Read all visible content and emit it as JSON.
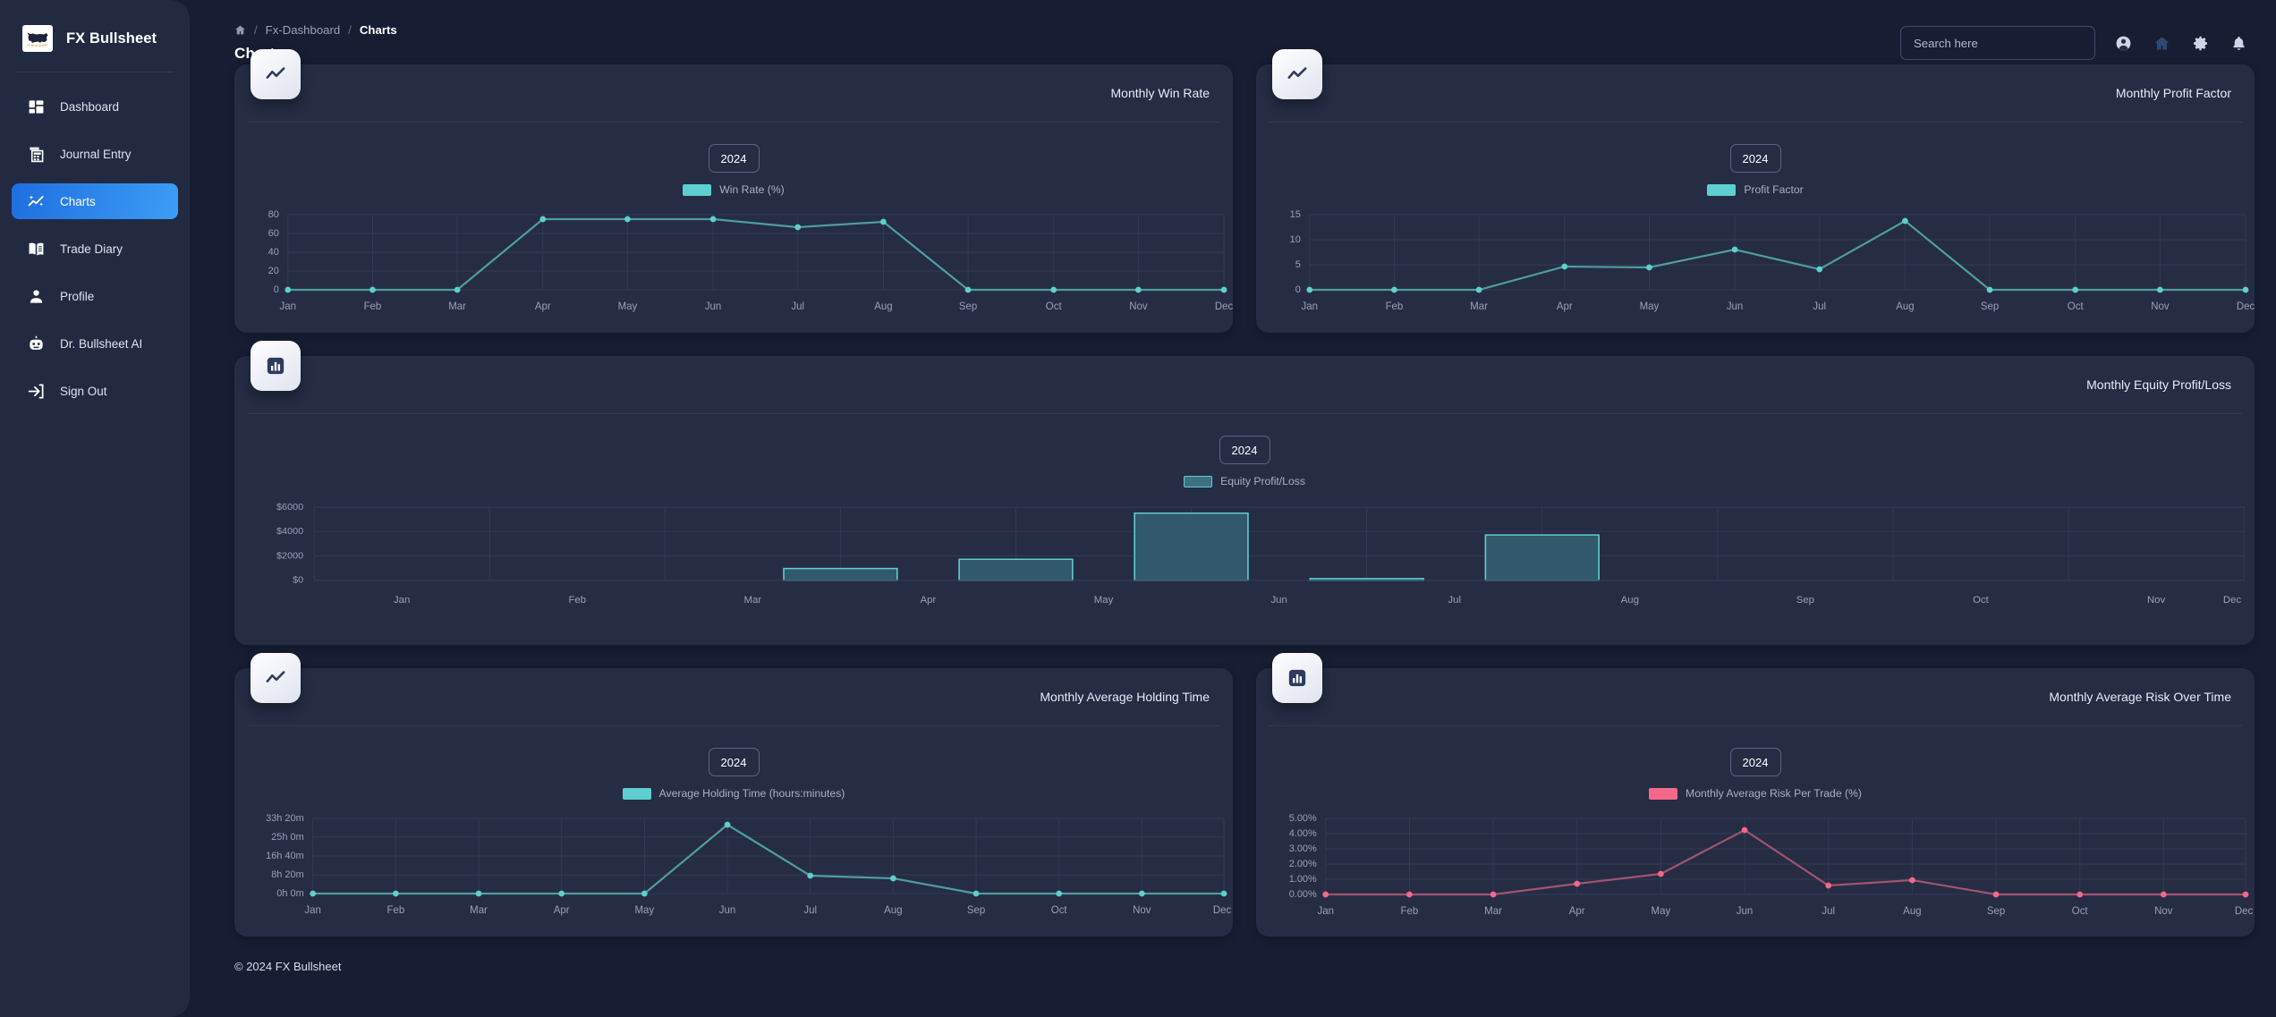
{
  "brand": {
    "name": "FX Bullsheet",
    "logo_icon": "bull-logo",
    "logo_word": "FX BULLSHEET"
  },
  "sidebar": {
    "items": [
      {
        "label": "Dashboard",
        "icon": "dashboard-icon",
        "active": false
      },
      {
        "label": "Journal Entry",
        "icon": "journal-icon",
        "active": false
      },
      {
        "label": "Charts",
        "icon": "charts-icon",
        "active": true
      },
      {
        "label": "Trade Diary",
        "icon": "book-icon",
        "active": false
      },
      {
        "label": "Profile",
        "icon": "person-icon",
        "active": false
      },
      {
        "label": "Dr. Bullsheet AI",
        "icon": "robot-icon",
        "active": false
      },
      {
        "label": "Sign Out",
        "icon": "sign-out-icon",
        "active": false
      }
    ],
    "active_color": "#2f86ec"
  },
  "header": {
    "breadcrumb": {
      "home_icon": "home-icon",
      "parent": "Fx-Dashboard",
      "current": "Charts",
      "separator": "/"
    },
    "page_title": "Charts",
    "search": {
      "placeholder": "Search here",
      "value": ""
    },
    "icons": [
      {
        "name": "account-icon"
      },
      {
        "name": "home-icon"
      },
      {
        "name": "gear-icon"
      },
      {
        "name": "bell-icon"
      }
    ]
  },
  "footer": {
    "text": "© 2024 FX Bullsheet"
  },
  "common": {
    "year": "2024",
    "months": [
      "Jan",
      "Feb",
      "Mar",
      "Apr",
      "May",
      "Jun",
      "Jul",
      "Aug",
      "Sep",
      "Oct",
      "Nov",
      "Dec"
    ],
    "accent_teal": "#5ecfce",
    "accent_pink": "#f4688a"
  },
  "cards": [
    {
      "title": "Monthly Win Rate",
      "icon": "line-chart-icon",
      "year": "2024"
    },
    {
      "title": "Monthly Profit Factor",
      "icon": "line-chart-icon",
      "year": "2024"
    },
    {
      "title": "Monthly Equity Profit/Loss",
      "icon": "bar-chart-icon",
      "year": "2024"
    },
    {
      "title": "Monthly Average Holding Time",
      "icon": "line-chart-icon",
      "year": "2024"
    },
    {
      "title": "Monthly Average Risk Over Time",
      "icon": "bar-chart-icon",
      "year": "2024"
    }
  ],
  "chart_data": [
    {
      "type": "line",
      "title": "Monthly Win Rate",
      "legend": [
        "Win Rate (%)"
      ],
      "legend_position": "top-center",
      "color": "#5ecfce",
      "categories": [
        "Jan",
        "Feb",
        "Mar",
        "Apr",
        "May",
        "Jun",
        "Jul",
        "Aug",
        "Sep",
        "Oct",
        "Nov",
        "Dec"
      ],
      "values": [
        0,
        0,
        0,
        75,
        75,
        75,
        66,
        72,
        0,
        0,
        0,
        0
      ],
      "yticks": [
        "0",
        "20",
        "40",
        "60",
        "80"
      ],
      "ylim": [
        0,
        80
      ],
      "xlabel": "",
      "ylabel": "",
      "grid": true
    },
    {
      "type": "line",
      "title": "Monthly Profit Factor",
      "legend": [
        "Profit Factor"
      ],
      "legend_position": "top-center",
      "color": "#5ecfce",
      "categories": [
        "Jan",
        "Feb",
        "Mar",
        "Apr",
        "May",
        "Jun",
        "Jul",
        "Aug",
        "Sep",
        "Oct",
        "Nov",
        "Dec"
      ],
      "values": [
        0,
        0,
        0,
        4.6,
        4.5,
        8.1,
        4.1,
        13.7,
        0,
        0,
        0,
        0
      ],
      "yticks": [
        "0",
        "5",
        "10",
        "15"
      ],
      "ylim": [
        0,
        15
      ],
      "xlabel": "",
      "ylabel": "",
      "grid": true
    },
    {
      "type": "bar",
      "title": "Monthly Equity Profit/Loss",
      "legend": [
        "Equity Profit/Loss"
      ],
      "legend_position": "top-center",
      "color": "#3f7080",
      "categories": [
        "Jan",
        "Feb",
        "Mar",
        "Apr",
        "May",
        "Jun",
        "Jul",
        "Aug",
        "Sep",
        "Oct",
        "Nov",
        "Dec"
      ],
      "values": [
        0,
        0,
        0,
        1000,
        1750,
        5500,
        120,
        3700,
        0,
        0,
        0,
        0
      ],
      "yticks": [
        "$0",
        "$2000",
        "$4000",
        "$6000"
      ],
      "ylim": [
        0,
        6000
      ],
      "xlabel": "",
      "ylabel": "",
      "grid": true
    },
    {
      "type": "line",
      "title": "Monthly Average Holding Time",
      "legend": [
        "Average Holding Time (hours:minutes)"
      ],
      "legend_position": "top-center",
      "color": "#5ecfce",
      "categories": [
        "Jan",
        "Feb",
        "Mar",
        "Apr",
        "May",
        "Jun",
        "Jul",
        "Aug",
        "Sep",
        "Oct",
        "Nov",
        "Dec"
      ],
      "values": [
        0,
        0,
        0,
        0,
        0,
        31.0,
        8.0,
        6.8,
        0,
        0,
        0,
        0
      ],
      "yticks": [
        "0h 0m",
        "8h 20m",
        "16h 40m",
        "25h 0m",
        "33h 20m"
      ],
      "ylim": [
        0,
        33.33
      ],
      "xlabel": "",
      "ylabel": "",
      "grid": true
    },
    {
      "type": "line",
      "title": "Monthly Average Risk Over Time",
      "legend": [
        "Monthly Average Risk Per Trade (%)"
      ],
      "legend_position": "top-center",
      "color": "#f4688a",
      "categories": [
        "Jan",
        "Feb",
        "Mar",
        "Apr",
        "May",
        "Jun",
        "Jul",
        "Aug",
        "Sep",
        "Oct",
        "Nov",
        "Dec"
      ],
      "values": [
        0,
        0,
        0,
        0.7,
        1.35,
        4.25,
        0.62,
        0.92,
        0,
        0,
        0,
        0
      ],
      "yticks": [
        "0.00%",
        "1.00%",
        "2.00%",
        "3.00%",
        "4.00%",
        "5.00%"
      ],
      "ylim": [
        0,
        5
      ],
      "xlabel": "",
      "ylabel": "",
      "grid": true
    }
  ]
}
